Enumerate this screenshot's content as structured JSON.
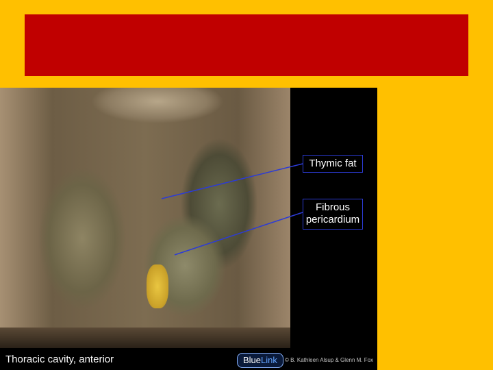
{
  "slide": {
    "title": ""
  },
  "figure": {
    "labels": {
      "thymic_fat": "Thymic fat",
      "fibrous_line1": "Fibrous",
      "fibrous_line2": "pericardium"
    },
    "caption": "Thoracic cavity, anterior",
    "logo": {
      "part1": "Blue",
      "part2": "Link"
    },
    "credit": "© B. Kathleen Alsup & Glenn M. Fox"
  },
  "colors": {
    "background": "#FFC000",
    "title_bar": "#C00000",
    "leader_line": "#2c3bd6"
  }
}
